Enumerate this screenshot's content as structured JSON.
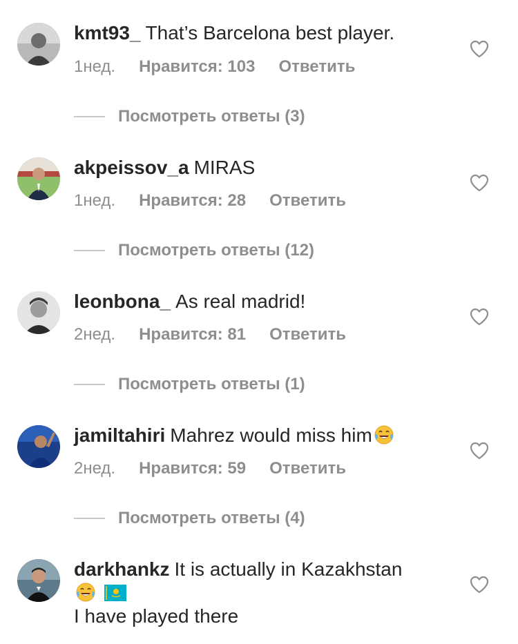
{
  "comments": [
    {
      "username": "kmt93_",
      "text": "That’s Barcelona best player.",
      "time": "1нед.",
      "likes": "Нравится: 103",
      "reply": "Ответить",
      "view_replies": "Посмотреть ответы (3)",
      "avatar_icon": "avatar-photo"
    },
    {
      "username": "akpeissov_a",
      "text": "MIRAS",
      "time": "1нед.",
      "likes": "Нравится: 28",
      "reply": "Ответить",
      "view_replies": "Посмотреть ответы (12)",
      "avatar_icon": "avatar-photo"
    },
    {
      "username": "leonbona_",
      "text": "As real madrid!",
      "time": "2нед.",
      "likes": "Нравится: 81",
      "reply": "Ответить",
      "view_replies": "Посмотреть ответы (1)",
      "avatar_icon": "avatar-photo"
    },
    {
      "username": "jamiltahiri",
      "text": "Mahrez would miss him",
      "emoji": "tears-of-joy-emoji",
      "time": "2нед.",
      "likes": "Нравится: 59",
      "reply": "Ответить",
      "view_replies": "Посмотреть ответы (4)",
      "avatar_icon": "avatar-photo"
    },
    {
      "username": "darkhankz",
      "text": "It is actually in Kazakhstan",
      "emoji": "tears-of-joy-emoji",
      "flag": "kazakhstan-flag",
      "text_line3": "I have played there",
      "avatar_icon": "avatar-photo"
    }
  ],
  "icons": {
    "like": "heart-outline-icon"
  },
  "colors": {
    "text": "#262626",
    "secondary": "#8e8e8e",
    "divider": "#c7c7c7",
    "background": "#ffffff"
  }
}
